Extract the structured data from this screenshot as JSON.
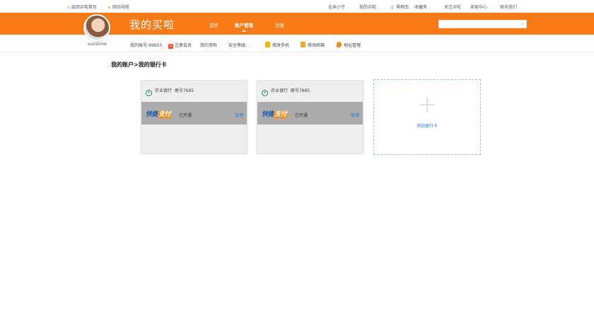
{
  "topbar": {
    "back_home": "返回买啦首页",
    "site_nav": "网站导航",
    "user": "吉米小子",
    "my_maila": "我的买啦",
    "cart": "购物车",
    "favorites": "收藏夹",
    "follow": "关注买啦",
    "seller_center": "卖家中心",
    "contact": "联系我们"
  },
  "header": {
    "brand": "我的买啦",
    "nav": [
      "首页",
      "账户管理",
      "消息"
    ],
    "active_nav": "账户管理",
    "search_placeholder": ""
  },
  "profile": {
    "username": "sunshine",
    "account_no": "我的账号:99653",
    "member": "注册会员",
    "my_info": "我的资料",
    "security": "安全等级:",
    "bind_phone": "修改手机",
    "bind_email": "修改邮箱",
    "address": "地址管理"
  },
  "breadcrumb": "我的账户>我的银行卡",
  "cards": [
    {
      "bank": "农业银行",
      "tail": "尾号7685",
      "pay_brand_a": "快捷",
      "pay_brand_b": "支付",
      "status": "已开通",
      "manage": "管理"
    },
    {
      "bank": "农业银行",
      "tail": "尾号7685",
      "pay_brand_a": "快捷",
      "pay_brand_b": "支付",
      "status": "已开通",
      "manage": "管理"
    }
  ],
  "add_card": {
    "plus": "+",
    "label": "添加银行卡"
  },
  "colors": {
    "brand_orange": "#f87a17",
    "link_blue": "#2f7bd8",
    "bank_green": "#1c8f54"
  }
}
